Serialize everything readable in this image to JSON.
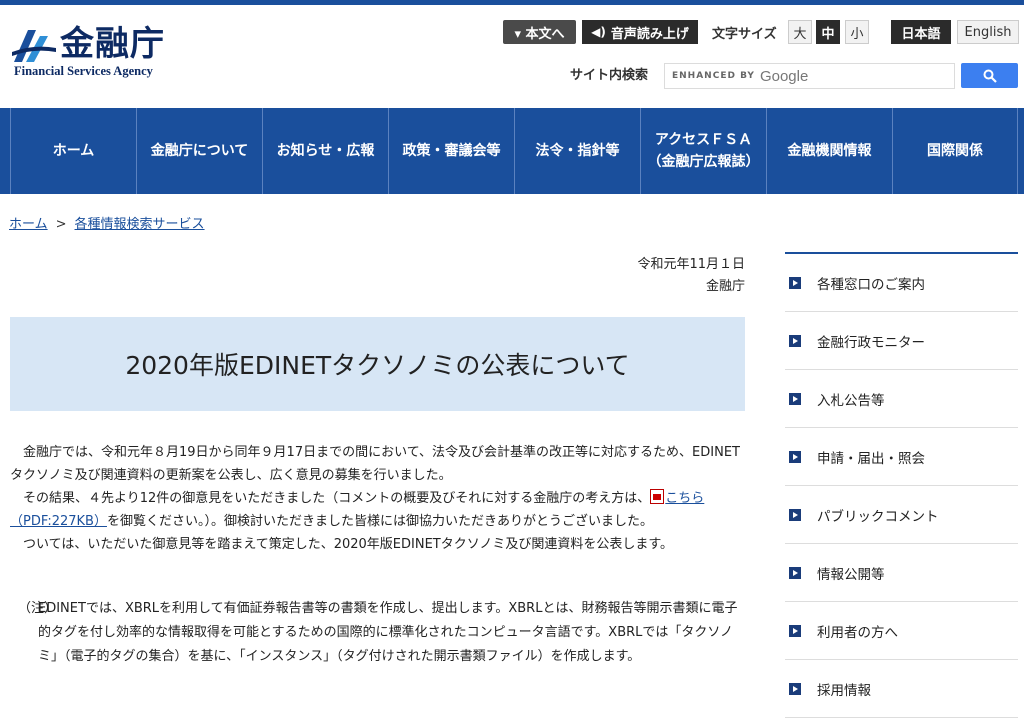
{
  "header": {
    "logo_jp": "金融庁",
    "logo_en": "Financial Services Agency",
    "skip_label": "▾ 本文へ",
    "voice_label": "音声読み上げ",
    "fontsize_label": "文字サイズ",
    "fontsize_large": "大",
    "fontsize_medium": "中",
    "fontsize_small": "小",
    "lang_ja": "日本語",
    "lang_en": "English",
    "search_label": "サイト内検索",
    "search_enhanced": "ENHANCED BY",
    "search_google": "Google"
  },
  "nav": {
    "items": [
      {
        "label": "ホーム"
      },
      {
        "label": "金融庁について"
      },
      {
        "label": "お知らせ・広報"
      },
      {
        "label": "政策・審議会等"
      },
      {
        "label": "法令・指針等"
      },
      {
        "label": "アクセスＦＳＡ\n（金融庁広報誌）"
      },
      {
        "label": "金融機関情報"
      },
      {
        "label": "国際関係"
      }
    ]
  },
  "breadcrumb": {
    "home": "ホーム",
    "sep": ">",
    "current": "各種情報検索サービス"
  },
  "main": {
    "date": "令和元年11月１日",
    "issuer": "金融庁",
    "title": "2020年版EDINETタクソノミの公表について",
    "p1": "金融庁では、令和元年８月19日から同年９月17日までの間において、法令及び会計基準の改正等に対応するため、EDINETタクソノミ及び関連資料の更新案を公表し、広く意見の募集を行いました。",
    "p2_before": "その結果、４先より12件の御意見をいただきました（コメントの概要及びそれに対する金融庁の考え方は、",
    "p2_link": "こちら（PDF:227KB）",
    "p2_after": "を御覧ください。）。御検討いただきました皆様には御協力いただきありがとうございました。",
    "p3": "ついては、いただいた御意見等を踏まえて策定した、2020年版EDINETタクソノミ及び関連資料を公表します。",
    "note_label": "（注）",
    "note_text": "EDINETでは、XBRLを利用して有価証券報告書等の書類を作成し、提出します。XBRLとは、財務報告等開示書類に電子的タグを付し効率的な情報取得を可能とするための国際的に標準化されたコンピュータ言語です。XBRLでは「タクソノミ」（電子的タグの集合）を基に、「インスタンス」（タグ付けされた開示書類ファイル）を作成します。"
  },
  "sidebar": {
    "items": [
      {
        "label": "各種窓口のご案内"
      },
      {
        "label": "金融行政モニター"
      },
      {
        "label": "入札公告等"
      },
      {
        "label": "申請・届出・照会"
      },
      {
        "label": "パブリックコメント"
      },
      {
        "label": "情報公開等"
      },
      {
        "label": "利用者の方へ"
      },
      {
        "label": "採用情報"
      }
    ]
  },
  "colors": {
    "brand_blue": "#1a4f9c",
    "title_bg": "#d7e6f5",
    "search_button": "#3c7ff0"
  }
}
